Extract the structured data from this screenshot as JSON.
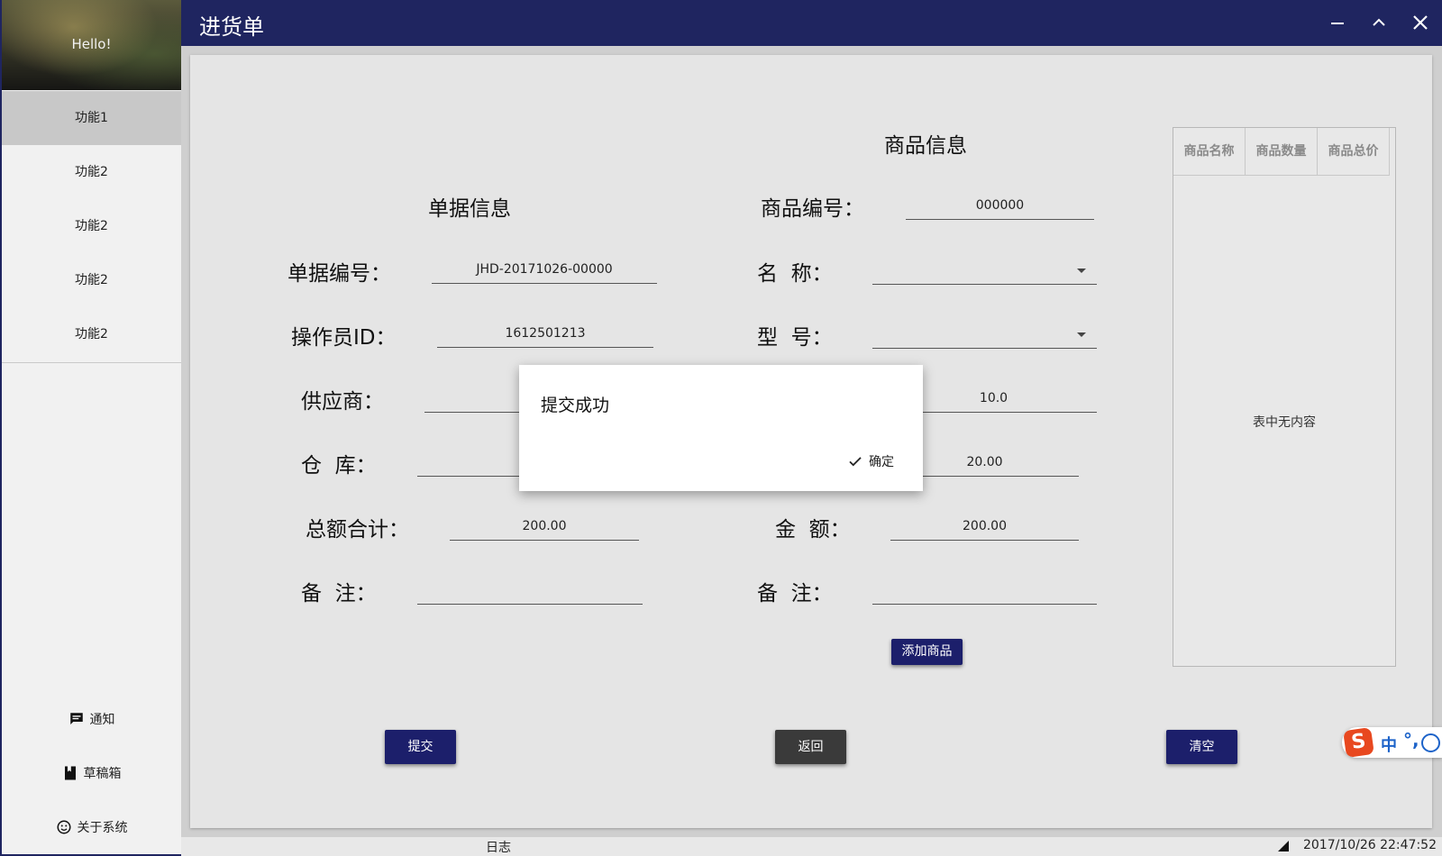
{
  "window": {
    "title": "进货单"
  },
  "sidebar": {
    "greeting": "Hello!",
    "items": [
      {
        "label": "功能1",
        "active": true
      },
      {
        "label": "功能2"
      },
      {
        "label": "功能2"
      },
      {
        "label": "功能2"
      },
      {
        "label": "功能2"
      }
    ],
    "bottom": [
      {
        "label": "通知",
        "icon": "message-icon"
      },
      {
        "label": "草稿箱",
        "icon": "bookmark-icon"
      },
      {
        "label": "关于系统",
        "icon": "smiley-icon"
      }
    ]
  },
  "form": {
    "doc_heading": "单据信息",
    "goods_heading": "商品信息",
    "doc": {
      "number_label": "单据编号：",
      "number_value": "JHD-20171026-00000",
      "operator_label": "操作员ID：",
      "operator_value": "1612501213",
      "supplier_label": "供应商：",
      "supplier_value": "",
      "warehouse_label": "仓  库：",
      "warehouse_value": "",
      "total_label": "总额合计：",
      "total_value": "200.00",
      "note_label": "备  注：",
      "note_value": ""
    },
    "goods": {
      "code_label": "商品编号：",
      "code_value": "000000",
      "name_label": "名  称：",
      "name_value": "",
      "model_label": "型  号：",
      "model_value": "",
      "field4_value": "10.0",
      "field5_value": "20.00",
      "amount_label": "金  额：",
      "amount_value": "200.00",
      "note_label": "备  注：",
      "note_value": ""
    },
    "add_goods_label": "添加商品"
  },
  "table": {
    "columns": [
      "商品名称",
      "商品数量",
      "商品总价"
    ],
    "empty_text": "表中无内容"
  },
  "actions": {
    "submit_label": "提交",
    "back_label": "返回",
    "clear_label": "清空"
  },
  "dialog": {
    "message": "提交成功",
    "confirm_label": "确定"
  },
  "statusbar": {
    "log_label": "日志",
    "datetime": "2017/10/26 22:47:52"
  },
  "ime": {
    "logo": "S",
    "mode": "中",
    "punct": "°,"
  },
  "colors": {
    "navy": "#1f2560",
    "button_navy": "#1c1f6b",
    "button_dark": "#3a3a3a"
  }
}
